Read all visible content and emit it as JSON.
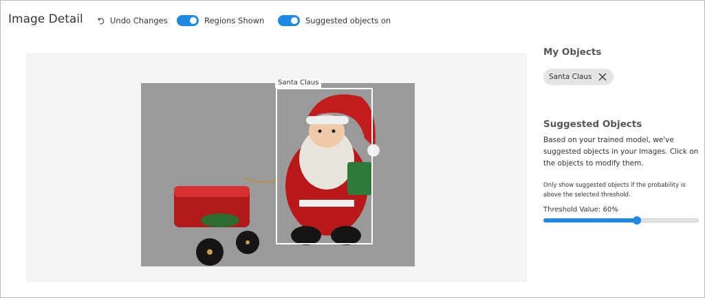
{
  "header": {
    "title": "Image Detail",
    "undo_label": "Undo Changes",
    "regions_toggle": {
      "label": "Regions Shown",
      "on": true
    },
    "suggested_toggle": {
      "label": "Suggested objects on",
      "on": true
    }
  },
  "image": {
    "region": {
      "label": "Santa Claus"
    }
  },
  "my_objects": {
    "title": "My Objects",
    "tags": [
      {
        "label": "Santa Claus"
      }
    ]
  },
  "suggested_objects": {
    "title": "Suggested Objects",
    "description": "Based on your trained model, we've suggested objects in your images. Click on the objects to modify them.",
    "threshold_note": "Only show suggested objects if the probability is above the selected threshold.",
    "threshold_label": "Threshold Value: 60%",
    "threshold_value": 0.6
  },
  "colors": {
    "accent": "#1e88e5",
    "image_overlay": "#9a9a9a",
    "panel_bg": "#f4f4f4"
  }
}
